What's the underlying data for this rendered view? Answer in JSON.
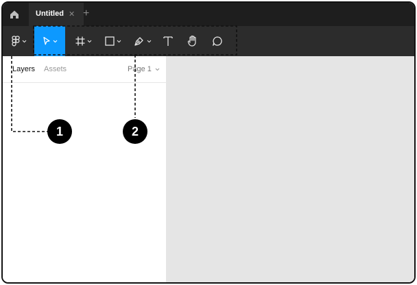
{
  "tabbar": {
    "home_icon": "home-icon",
    "tab_title": "Untitled",
    "tab_close": "✕",
    "new_tab": "+"
  },
  "toolbar": {
    "tools": [
      {
        "name": "main-menu",
        "icon": "figma-logo-icon",
        "has_menu": true
      },
      {
        "name": "move",
        "icon": "cursor-arrow-icon",
        "has_menu": true,
        "active": true
      },
      {
        "name": "frame",
        "icon": "frame-hash-icon",
        "has_menu": true
      },
      {
        "name": "shape",
        "icon": "rectangle-icon",
        "has_menu": true
      },
      {
        "name": "pen",
        "icon": "pen-icon",
        "has_menu": true
      },
      {
        "name": "text",
        "icon": "text-t-icon",
        "has_menu": false
      },
      {
        "name": "hand",
        "icon": "hand-icon",
        "has_menu": false
      },
      {
        "name": "comment",
        "icon": "comment-bubble-icon",
        "has_menu": false
      }
    ],
    "accent": "#0d99ff"
  },
  "panel": {
    "tab_layers": "Layers",
    "tab_assets": "Assets",
    "page_selector": "Page 1"
  },
  "callouts": {
    "one": "1",
    "two": "2"
  },
  "colors": {
    "dark_bar": "#1e1e1e",
    "toolbar": "#2c2c2c",
    "canvas": "#e5e5e5"
  }
}
